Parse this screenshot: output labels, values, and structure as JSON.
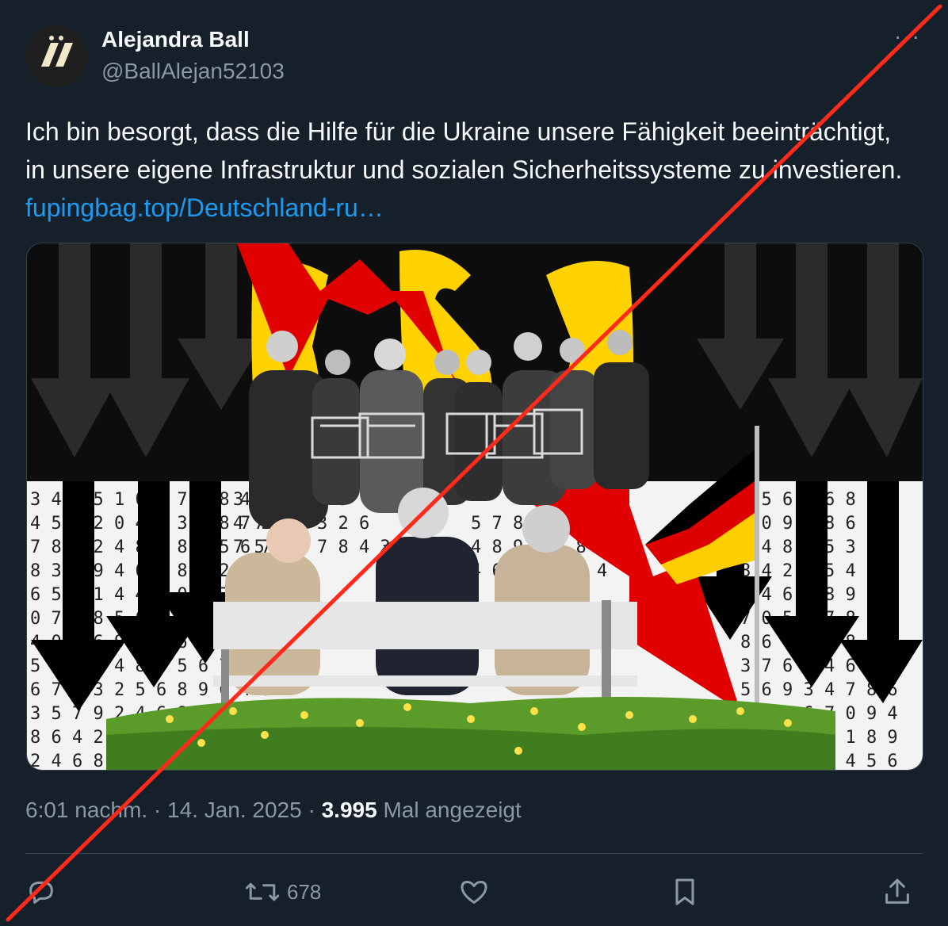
{
  "author": {
    "name": "Alejandra Ball",
    "handle": "@BallAlejan52103"
  },
  "tweet": {
    "text": "Ich bin besorgt, dass die Hilfe für die Ukraine unsere Fähigkeit beeinträchtigt, in unsere eigene Infrastruktur und sozialen Sicherheitssysteme zu investieren. ",
    "link": "fupingbag.top/Deutschland-ru…"
  },
  "meta": {
    "time": "6:01 nachm.",
    "separator": " · ",
    "date": "14. Jan. 2025",
    "views_count": "3.995",
    "views_label": " Mal angezeigt"
  },
  "actions": {
    "reply_icon": "reply-icon",
    "retweet_icon": "retweet-icon",
    "retweet_count": "678",
    "like_icon": "heart-icon",
    "bookmark_icon": "bookmark-icon",
    "share_icon": "share-icon"
  },
  "colors": {
    "background": "#15202b",
    "link": "#1d9bf0",
    "overlay_cross": "#ff2a1a"
  }
}
